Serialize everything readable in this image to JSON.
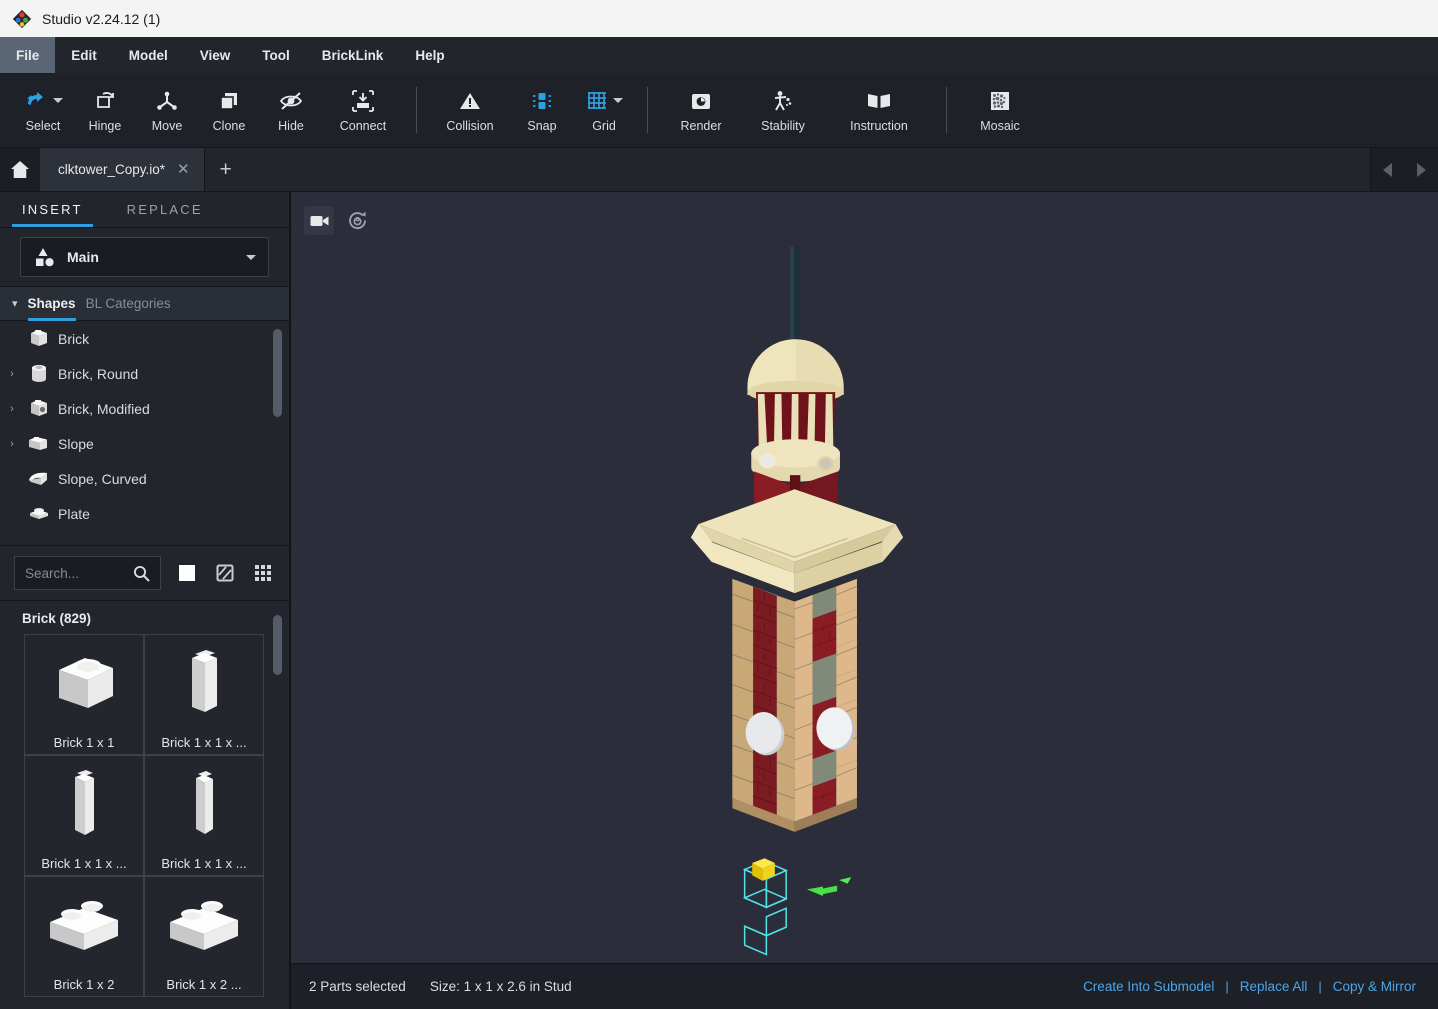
{
  "window": {
    "title": "Studio v2.24.12 (1)",
    "logo_icon": "studio-diamond-logo"
  },
  "menubar": {
    "items": [
      {
        "label": "File",
        "active": true
      },
      {
        "label": "Edit",
        "active": false
      },
      {
        "label": "Model",
        "active": false
      },
      {
        "label": "View",
        "active": false
      },
      {
        "label": "Tool",
        "active": false
      },
      {
        "label": "BrickLink",
        "active": false
      },
      {
        "label": "Help",
        "active": false
      }
    ]
  },
  "toolbar": {
    "tools": [
      {
        "label": "Select",
        "icon": "select-cursor-icon",
        "has_caret": true,
        "accent": "#2f9fe0"
      },
      {
        "label": "Hinge",
        "icon": "hinge-icon",
        "has_caret": false
      },
      {
        "label": "Move",
        "icon": "move-axes-icon",
        "has_caret": false
      },
      {
        "label": "Clone",
        "icon": "clone-copy-icon",
        "has_caret": false
      },
      {
        "label": "Hide",
        "icon": "eye-slash-icon",
        "has_caret": false
      },
      {
        "label": "Connect",
        "icon": "connect-icon",
        "has_caret": false
      },
      {
        "label": "Collision",
        "icon": "collision-warning-icon",
        "has_caret": false
      },
      {
        "label": "Snap",
        "icon": "snap-icon",
        "has_caret": false,
        "accent": "#2f9fe0"
      },
      {
        "label": "Grid",
        "icon": "grid-icon",
        "has_caret": true,
        "accent": "#2f9fe0"
      },
      {
        "label": "Render",
        "icon": "camera-render-icon",
        "has_caret": false
      },
      {
        "label": "Stability",
        "icon": "stability-person-icon",
        "has_caret": false
      },
      {
        "label": "Instruction",
        "icon": "book-instruction-icon",
        "has_caret": false
      },
      {
        "label": "Mosaic",
        "icon": "mosaic-icon",
        "has_caret": false
      }
    ],
    "separators_after": [
      5,
      8,
      11
    ]
  },
  "tabbar": {
    "home_icon": "home-icon",
    "tabs": [
      {
        "title": "clktower_Copy.io*",
        "close_icon": "close-icon",
        "active": true
      }
    ],
    "new_tab_label": "+",
    "nav_prev_icon": "chevron-left-icon",
    "nav_next_icon": "chevron-right-icon"
  },
  "sidebar": {
    "mode_tabs": [
      {
        "label": "INSERT",
        "active": true
      },
      {
        "label": "REPLACE",
        "active": false
      }
    ],
    "palette_select": {
      "value": "Main",
      "icon": "shapes-group-icon",
      "caret_icon": "chevron-down-icon"
    },
    "category_header": {
      "collapse_icon": "chevron-down-icon",
      "shapes_label": "Shapes",
      "bl_categories_label": "BL Categories"
    },
    "categories": [
      {
        "label": "Brick",
        "expandable": false,
        "icon": "brick-icon"
      },
      {
        "label": "Brick, Round",
        "expandable": true,
        "icon": "brick-round-icon"
      },
      {
        "label": "Brick, Modified",
        "expandable": true,
        "icon": "brick-modified-icon"
      },
      {
        "label": "Slope",
        "expandable": true,
        "icon": "slope-icon"
      },
      {
        "label": "Slope, Curved",
        "expandable": false,
        "icon": "slope-curved-icon"
      },
      {
        "label": "Plate",
        "expandable": false,
        "icon": "plate-icon"
      }
    ],
    "search": {
      "placeholder": "Search...",
      "search_icon": "search-icon"
    },
    "view_toggles": [
      {
        "name": "color-swatch-toggle",
        "icon": "white-square-icon",
        "active": true
      },
      {
        "name": "pattern-toggle",
        "icon": "hatched-square-icon",
        "active": false
      },
      {
        "name": "grid-view-toggle",
        "icon": "grid-dots-icon",
        "active": false
      }
    ],
    "parts": {
      "group_title": "Brick (829)",
      "items": [
        {
          "label": "Brick 1 x 1",
          "shape": "brick-1x1"
        },
        {
          "label": "Brick 1 x 1 x ...",
          "shape": "brick-tall-a"
        },
        {
          "label": "Brick 1 x 1 x ...",
          "shape": "brick-tall-b"
        },
        {
          "label": "Brick 1 x 1 x ...",
          "shape": "brick-tall-c"
        },
        {
          "label": "Brick 1 x 2",
          "shape": "brick-1x2"
        },
        {
          "label": "Brick 1 x 2 ...",
          "shape": "brick-1x2-b"
        }
      ]
    }
  },
  "viewport": {
    "buttons": [
      {
        "name": "camera-button",
        "icon": "video-camera-icon"
      },
      {
        "name": "rotate-view-button",
        "icon": "rotate-refresh-icon"
      }
    ],
    "model": {
      "name": "clock-tower-model",
      "colors": {
        "tan_light": "#e8d7b0",
        "tan_mid": "#c9a878",
        "tan_dark": "#a98a60",
        "dark_red": "#8a1c24",
        "dark_red_shade": "#6e1319",
        "stone_green": "#7b8374",
        "stone_green_dark": "#636b5d",
        "cream": "#eadfb6",
        "cream_shade": "#d6c89b",
        "antenna": "#1f3038",
        "clock_face": "#e4e5e8",
        "selection": "#4fe3e8",
        "handle": "#f5d90a",
        "axis_arrow": "#4ae04a"
      }
    }
  },
  "statusbar": {
    "selection_text": "2 Parts selected",
    "size_text": "Size: 1 x 1 x 2.6 in Stud",
    "actions": [
      {
        "label": "Create Into Submodel"
      },
      {
        "label": "Replace All"
      },
      {
        "label": "Copy & Mirror"
      }
    ],
    "separator": "|",
    "link_color": "#4ca6e8"
  }
}
